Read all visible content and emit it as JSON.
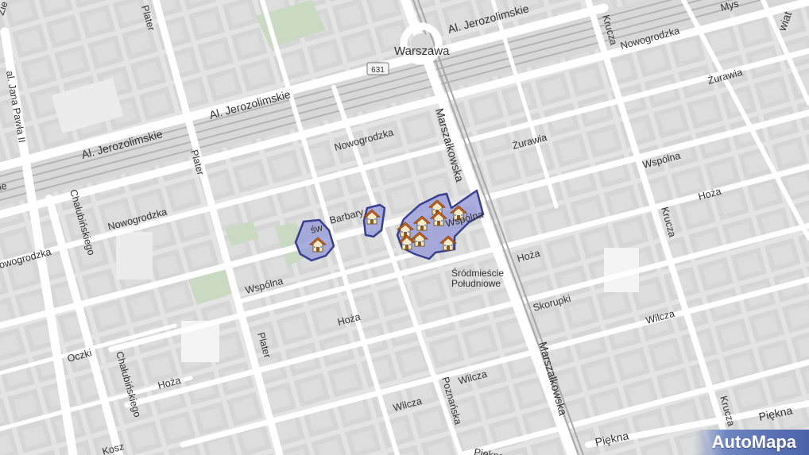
{
  "map": {
    "city_label": "Warszawa",
    "district_label": [
      "Śródmieście",
      "Południowe"
    ],
    "route_shield": "631",
    "attribution": "AutoMapa",
    "streets": {
      "jerozolimskie_top": "Al. Jerozolimskie",
      "jerozolimskie_mid": "Al. Jerozolimskie",
      "jerozolimskie_left": "Al. Jerozolimskie",
      "jana_pawla": "al. Jana Pawła II",
      "chalubinskiego_top": "Chałubińskiego",
      "chalubinskiego_bottom": "Chałubińskiego",
      "plater_top": "Plater",
      "plater_mid": "Plater",
      "plater_bottom": "Plater",
      "nowogrodzka_left": "Nowogrodzka",
      "nowogrodzka_mid": "Nowogrodzka",
      "nowogrodzka_top": "Nowogrodzka",
      "nowogrodzka_edge": "owogrodzka",
      "marszalkowska_top": "Marszałkowska",
      "marszalkowska_bottom": "Marszałkowska",
      "krucza_top": "Krucza",
      "krucza_mid": "Krucza",
      "krucza_bottom": "Krucza",
      "zurawia_right": "Żurawia",
      "zurawia_mid": "Żurawia",
      "wspolna_right": "Wspólna",
      "wspolna_mid": "Wspólna",
      "wspolna_left": "Wspólna",
      "hoza_right": "Hoża",
      "hoza_mid": "Hoża",
      "hoza_left": "Hoża",
      "hoza_far": "Hoża",
      "barbary": "Barbary",
      "sw": "św",
      "skorupki": "Skorupki",
      "wilcza_right": "Wilcza",
      "wilcza_mid": "Wilcza",
      "wilcza_left": "Wilcza",
      "oczki": "Oczki",
      "poznanska": "Poznańska",
      "piekna_bottom": "Piękna",
      "piekna_right": "Piękna",
      "piekna_left": "Piękna",
      "kosz": "Kosz",
      "mys": "Mys",
      "wiat": "wiat",
      "zie": "Zie",
      "ie": "ie"
    },
    "colors": {
      "background": "#e4e4e4",
      "block": "#d2d2d2",
      "road": "#ffffff",
      "rail": "#b8b8b8",
      "park": "#c8d8c0",
      "highlight_fill": "#9aa0d8",
      "highlight_stroke": "#3a3f8f",
      "text": "#333333"
    },
    "marker_icon": "house-icon"
  }
}
